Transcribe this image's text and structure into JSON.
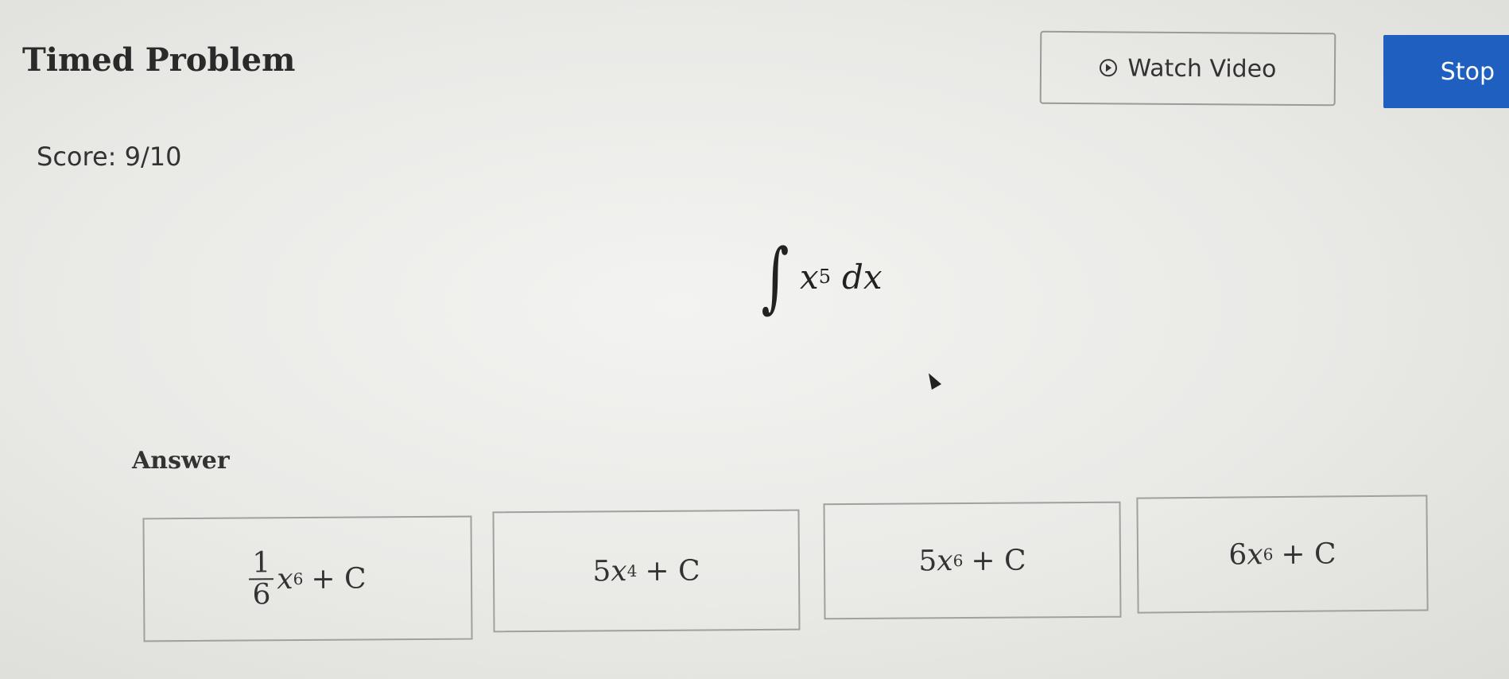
{
  "header": {
    "title": "Timed Problem",
    "watch_video_label": "Watch Video",
    "stop_label": "Stop"
  },
  "score": {
    "text": "Score: 9/10"
  },
  "problem": {
    "integral_sign": "∫",
    "base": "x",
    "exponent": "5",
    "differential": "dx"
  },
  "answer": {
    "label": "Answer",
    "choices": [
      {
        "frac_num": "1",
        "frac_den": "6",
        "var": "x",
        "exp": "6",
        "rest": "+ C"
      },
      {
        "coef": "5",
        "var": "x",
        "exp": "4",
        "rest": "+ C"
      },
      {
        "coef": "5",
        "var": "x",
        "exp": "6",
        "rest": "+ C"
      },
      {
        "coef": "6",
        "var": "x",
        "exp": "6",
        "rest": "+ C"
      }
    ]
  },
  "icons": {
    "watch_video": "play-circle-icon",
    "pointer": "mouse-cursor-icon"
  },
  "colors": {
    "stop_button": "#1f5fbf",
    "background": "#ebebe8"
  }
}
